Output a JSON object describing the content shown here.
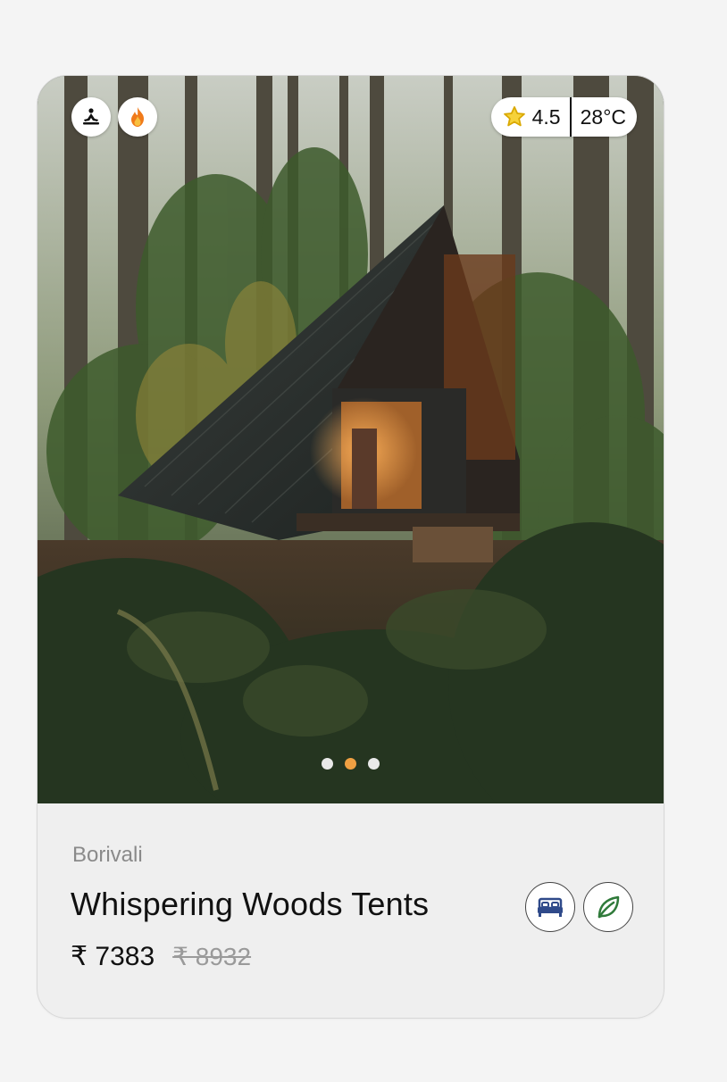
{
  "listing": {
    "location": "Borivali",
    "title": "Whispering Woods Tents",
    "price": "₹ 7383",
    "original_price": "₹ 8932",
    "rating": "4.5",
    "temperature": "28°C"
  },
  "tags": [
    {
      "icon": "meditation-icon"
    },
    {
      "icon": "campfire-icon"
    }
  ],
  "amenities": [
    {
      "icon": "bed-icon",
      "color": "#2f4a8a"
    },
    {
      "icon": "leaf-icon",
      "color": "#2f7a3a"
    }
  ],
  "carousel": {
    "count": 3,
    "active_index": 1,
    "active_color": "#f0a042"
  }
}
